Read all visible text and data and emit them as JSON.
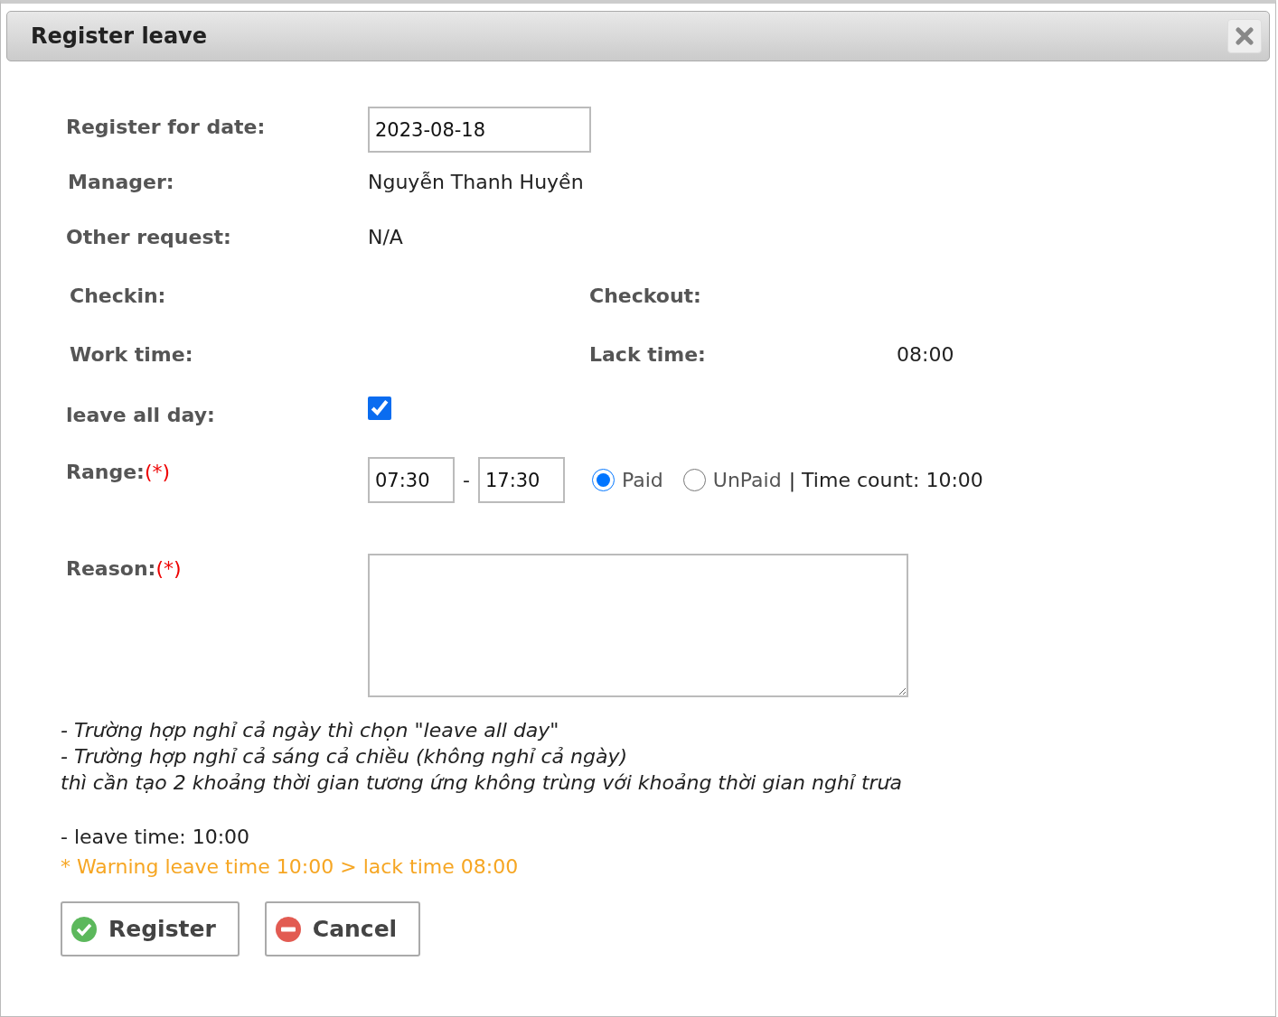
{
  "dialog": {
    "title": "Register leave"
  },
  "register_date": {
    "label": "Register for date:",
    "value": "2023-08-18"
  },
  "manager": {
    "label": "Manager:",
    "value": "Nguyễn Thanh Huyền"
  },
  "other_request": {
    "label": "Other request:",
    "value": "N/A"
  },
  "checkin": {
    "label": "Checkin:"
  },
  "checkout": {
    "label": "Checkout:"
  },
  "work_time": {
    "label": "Work time:"
  },
  "lack_time": {
    "label": "Lack time:",
    "value": "08:00"
  },
  "leave_all_day": {
    "label": "leave all day:",
    "checked": true
  },
  "range": {
    "label": "Range:",
    "required": "(*)",
    "from": "07:30",
    "separator": "-",
    "to": "17:30",
    "options": [
      {
        "label": "Paid",
        "selected": true
      },
      {
        "label": "UnPaid",
        "selected": false
      }
    ],
    "time_count": "| Time count: 10:00"
  },
  "reason": {
    "label": "Reason:",
    "required": "(*)"
  },
  "notes": [
    "- Trường hợp nghỉ cả ngày thì chọn \"leave all day\"",
    "- Trường hợp nghỉ cả sáng cả chiều (không nghỉ cả ngày)",
    "thì cần tạo 2 khoảng thời gian tương ứng không trùng với khoảng thời gian nghỉ trưa"
  ],
  "leave_time": "- leave time: 10:00",
  "warning": "* Warning leave time 10:00 > lack time 08:00",
  "buttons": [
    {
      "kind": "register",
      "label": "Register"
    },
    {
      "kind": "cancel",
      "label": "Cancel"
    }
  ]
}
